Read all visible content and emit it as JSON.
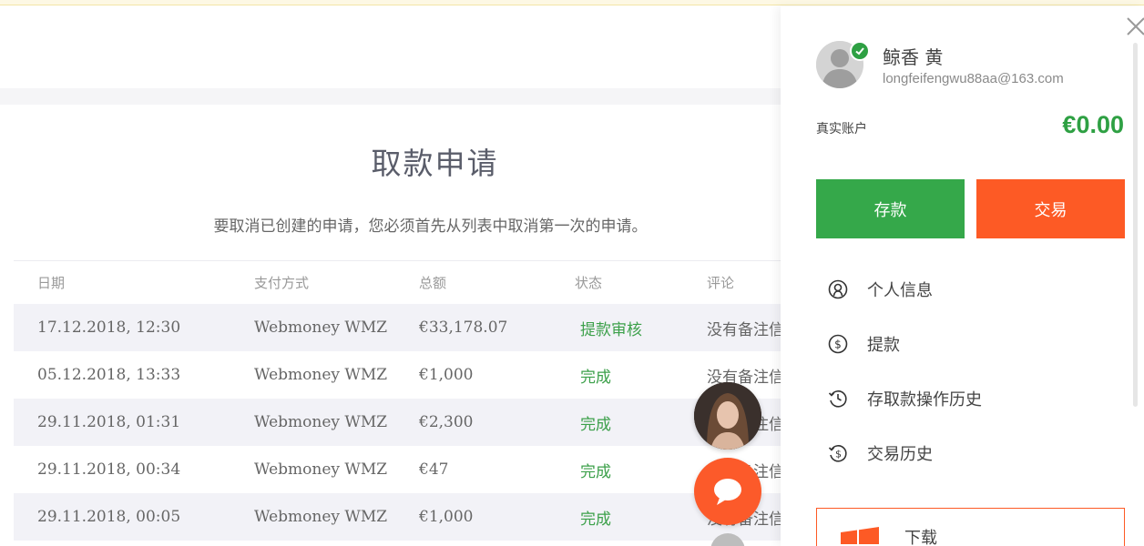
{
  "page": {
    "title": "取款申请",
    "subtitle": "要取消已创建的申请，您必须首先从列表中取消第一次的申请。"
  },
  "table": {
    "headers": [
      "日期",
      "支付方式",
      "总额",
      "状态",
      "评论"
    ],
    "rows": [
      {
        "date": "17.12.2018, 12:30",
        "method": "Webmoney WMZ",
        "amount": "€33,178.07",
        "status": "提款审核",
        "comment": "没有备注信息"
      },
      {
        "date": "05.12.2018, 13:33",
        "method": "Webmoney WMZ",
        "amount": "€1,000",
        "status": "完成",
        "comment": "没有备注信息"
      },
      {
        "date": "29.11.2018, 01:31",
        "method": "Webmoney WMZ",
        "amount": "€2,300",
        "status": "完成",
        "comment": "没有备注信息"
      },
      {
        "date": "29.11.2018, 00:34",
        "method": "Webmoney WMZ",
        "amount": "€47",
        "status": "完成",
        "comment": "没有备注信息"
      },
      {
        "date": "29.11.2018, 00:05",
        "method": "Webmoney WMZ",
        "amount": "€1,000",
        "status": "完成",
        "comment": "没有备注信息"
      }
    ]
  },
  "panel": {
    "user_name": "鲸香 黄",
    "user_email": "longfeifengwu88aa@163.com",
    "account_label": "真实账户",
    "balance": "€0.00",
    "deposit_label": "存款",
    "trade_label": "交易",
    "menu": [
      {
        "label": "个人信息",
        "icon": "user-circle-icon"
      },
      {
        "label": "提款",
        "icon": "dollar-circle-icon"
      },
      {
        "label": "存取款操作历史",
        "icon": "history-icon"
      },
      {
        "label": "交易历史",
        "icon": "trade-history-icon"
      }
    ],
    "download_label": "下载"
  },
  "colors": {
    "green": "#35a84a",
    "orange": "#fd5a25",
    "balance_green": "#2ea043"
  }
}
